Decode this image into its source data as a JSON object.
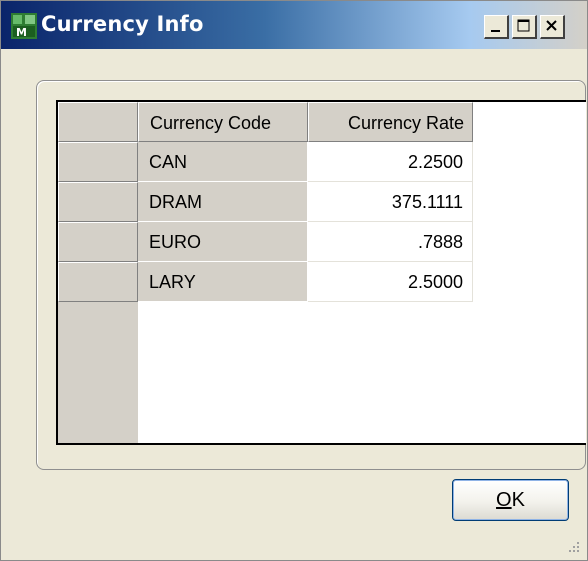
{
  "window": {
    "title": "Currency Info",
    "app_icon": "mas90-app-icon",
    "controls": {
      "minimize": "minimize-icon",
      "maximize": "maximize-icon",
      "close": "close-icon"
    }
  },
  "grid": {
    "columns": [
      "Currency Code",
      "Currency Rate"
    ],
    "rows": [
      {
        "code": "CAN",
        "rate": "2.2500"
      },
      {
        "code": "DRAM",
        "rate": "375.1111"
      },
      {
        "code": "EURO",
        "rate": ".7888"
      },
      {
        "code": "LARY",
        "rate": "2.5000"
      }
    ]
  },
  "buttons": {
    "ok_accel": "O",
    "ok_rest": "K"
  },
  "colors": {
    "title_start": "#0a246a",
    "title_end": "#a6caf0",
    "face": "#ece9d8",
    "header": "#d4d0c8"
  }
}
